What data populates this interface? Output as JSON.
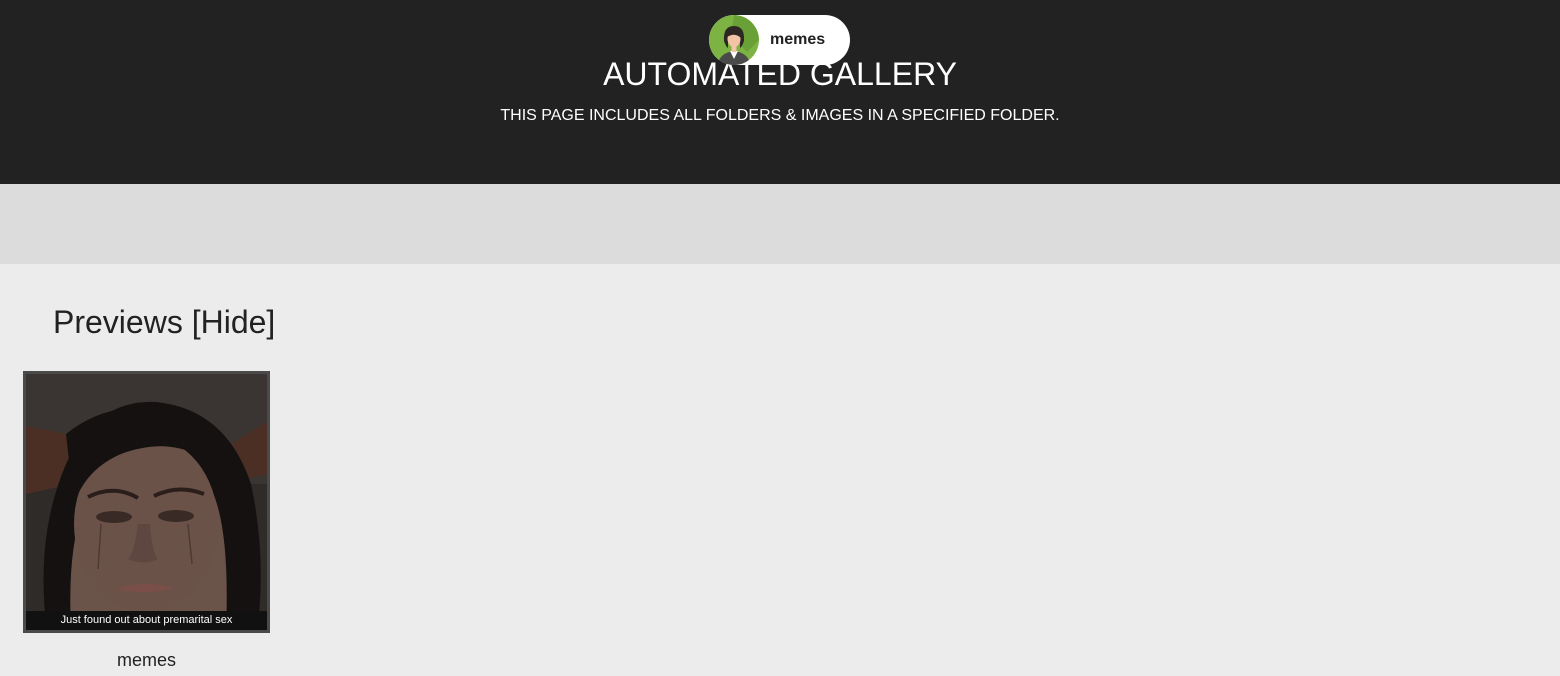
{
  "header": {
    "title": "AUTOMATED GALLERY",
    "subtitle": "THIS PAGE INCLUDES ALL FOLDERS & IMAGES IN A SPECIFIED FOLDER."
  },
  "folders": [
    {
      "label": "memes",
      "icon": "person-avatar-icon"
    }
  ],
  "previews": {
    "heading": "Previews",
    "toggle_label": "[Hide]",
    "items": [
      {
        "image_caption": "Just found out about premarital sex",
        "label": "memes"
      }
    ]
  },
  "colors": {
    "header_bg": "#222222",
    "folder_bar_bg": "#dcdcdc",
    "page_bg": "#ececec",
    "avatar_bg": "#7cb342"
  }
}
